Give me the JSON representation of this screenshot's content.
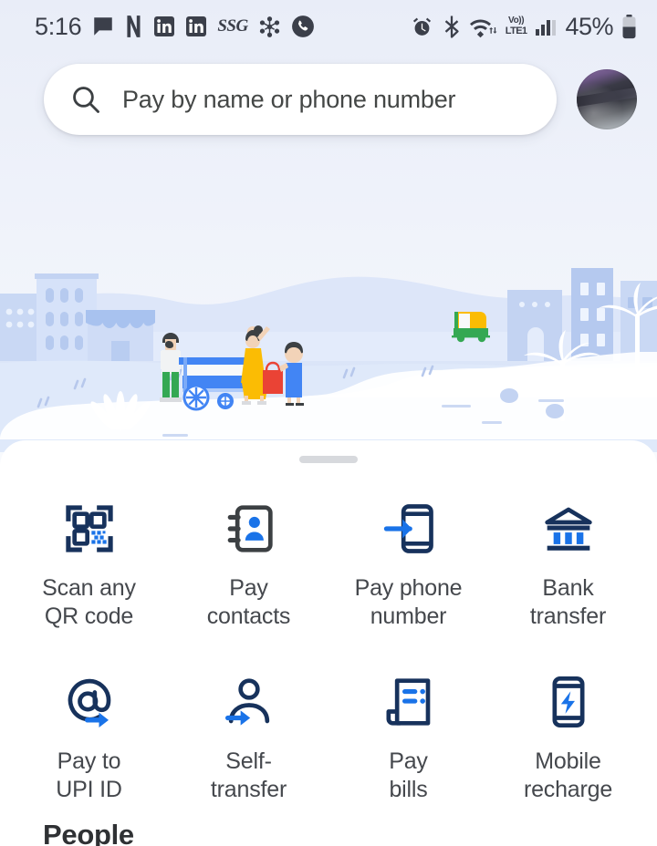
{
  "status_bar": {
    "time": "5:16",
    "left_icons": [
      {
        "name": "messages-icon",
        "label": "Messages"
      },
      {
        "name": "netflix-icon",
        "label": "N"
      },
      {
        "name": "linkedin-icon-1",
        "label": "in"
      },
      {
        "name": "linkedin-icon-2",
        "label": "in"
      },
      {
        "name": "ssg-icon",
        "label": "SSG"
      },
      {
        "name": "freeform-icon",
        "label": "Freeform"
      },
      {
        "name": "phone-call-icon",
        "label": "Call"
      }
    ],
    "right_icons": [
      {
        "name": "alarm-icon",
        "label": "Alarm"
      },
      {
        "name": "bluetooth-icon",
        "label": "Bluetooth"
      },
      {
        "name": "wifi-icon",
        "label": "Wi-Fi"
      }
    ],
    "network": {
      "voice": "Vo))",
      "tech": "LTE1"
    },
    "signal_bars": 3,
    "battery_percent": "45%"
  },
  "search": {
    "icon": "search-icon",
    "placeholder": "Pay by name or phone number",
    "value": ""
  },
  "avatar": {
    "name": "profile-avatar",
    "alt": "Profile picture"
  },
  "illustration": {
    "name": "city-scene-illustration",
    "alt": "Illustrated cityscape with a street food cart, family, auto rickshaw, buildings and palm trees",
    "colors": {
      "sky": "#ffffff",
      "hill": "#dae3f7",
      "ground": "#cfdcf5",
      "water": "#e4ecfb",
      "building": "#c3d3f2",
      "building_light": "#d7e2f8",
      "white": "#ffffff",
      "rickshaw_green": "#34a853",
      "rickshaw_yellow": "#fbbc04",
      "shirt_white": "#f5f5f5",
      "pants_green": "#34a853",
      "dress_yellow": "#fbbc04",
      "cart_blue": "#4285f4",
      "bag_red": "#ea4335",
      "child_blue": "#4285f4"
    }
  },
  "sheet": {
    "handle": "drag-handle",
    "actions": [
      {
        "id": "scan-any-qr-code",
        "icon": "qr-code-scanner-icon",
        "line1": "Scan any",
        "line2": "QR code"
      },
      {
        "id": "pay-contacts",
        "icon": "contacts-book-icon",
        "line1": "Pay",
        "line2": "contacts"
      },
      {
        "id": "pay-phone-number",
        "icon": "phone-arrow-icon",
        "line1": "Pay phone",
        "line2": "number"
      },
      {
        "id": "bank-transfer",
        "icon": "bank-icon",
        "line1": "Bank",
        "line2": "transfer"
      },
      {
        "id": "pay-to-upi-id",
        "icon": "at-sign-arrow-icon",
        "line1": "Pay to",
        "line2": "UPI ID"
      },
      {
        "id": "self-transfer",
        "icon": "person-arrow-icon",
        "line1": "Self-",
        "line2": "transfer"
      },
      {
        "id": "pay-bills",
        "icon": "receipt-icon",
        "line1": "Pay",
        "line2": "bills"
      },
      {
        "id": "mobile-recharge",
        "icon": "phone-bolt-icon",
        "line1": "Mobile",
        "line2": "recharge"
      }
    ],
    "people_heading": "People"
  },
  "theme": {
    "navy": "#17325c",
    "blue": "#1a73e8",
    "dark_gray": "#3c4043",
    "text": "#45484d",
    "page_top": "#e9edf8"
  }
}
